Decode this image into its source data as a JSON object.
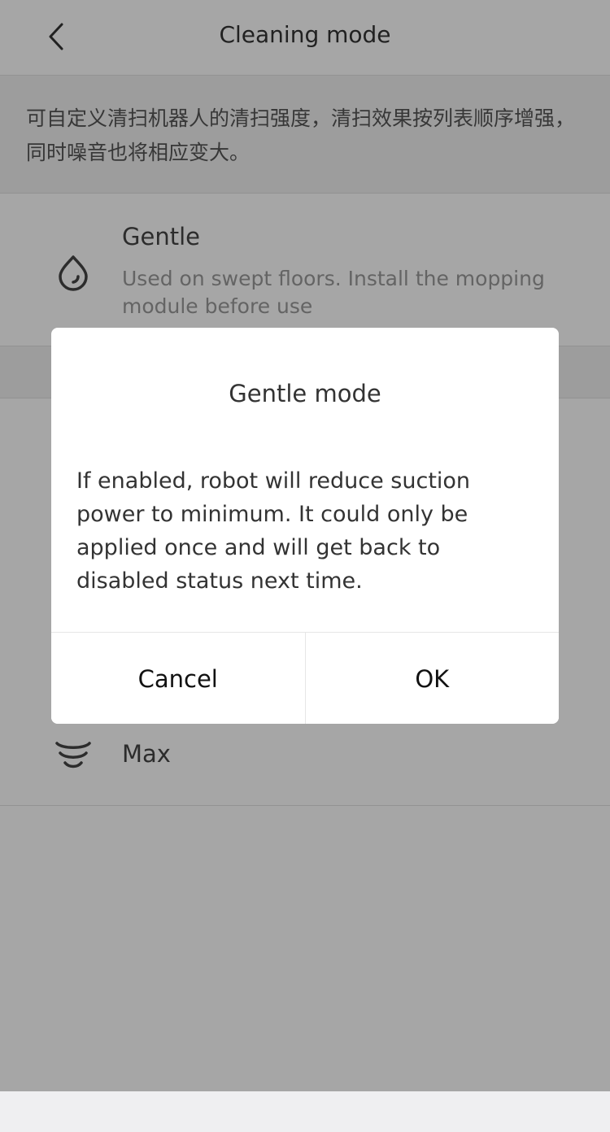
{
  "header": {
    "title": "Cleaning mode",
    "back_icon": "chevron-left-icon"
  },
  "description": "可自定义清扫机器人的清扫强度，清扫效果按列表顺序增强，同时噪音也将相应变大。",
  "options": {
    "gentle": {
      "title": "Gentle",
      "subtitle": "Used on swept floors. Install the mopping module before use",
      "icon": "water-drop-icon"
    },
    "max": {
      "title": "Max",
      "icon": "tornado-icon"
    }
  },
  "dialog": {
    "title": "Gentle mode",
    "message": "If enabled, robot will reduce suction power to minimum. It could only be applied once and will get back to disabled status next time.",
    "cancel_label": "Cancel",
    "ok_label": "OK"
  }
}
